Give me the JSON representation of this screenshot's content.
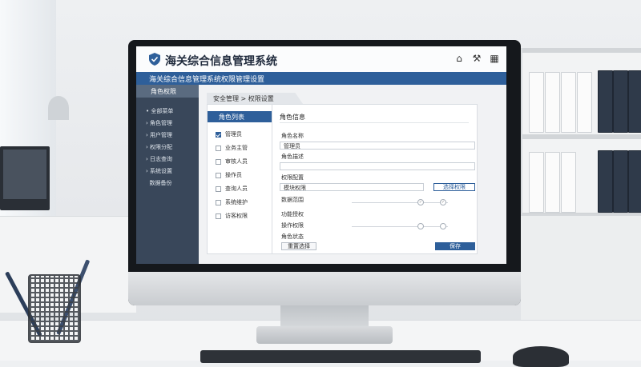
{
  "app": {
    "title": "海关综合信息管理系统",
    "tab_title": "海关综合信息管理系统权限管理设置"
  },
  "toolbar": {
    "home_icon": "⌂",
    "tools_icon": "⚒",
    "grid_icon": "▦"
  },
  "sidebar": {
    "header": "角色权限",
    "items": [
      {
        "label": "全部菜单"
      },
      {
        "label": "角色管理"
      },
      {
        "label": "用户管理"
      },
      {
        "label": "权限分配"
      },
      {
        "label": "日志查询"
      },
      {
        "label": "系统设置"
      },
      {
        "label": "数据备份"
      }
    ]
  },
  "breadcrumb": "安全管理 > 权限设置",
  "roles": {
    "header": "角色列表",
    "items": [
      {
        "label": "管理员",
        "checked": true
      },
      {
        "label": "业务主管",
        "checked": false
      },
      {
        "label": "审核人员",
        "checked": false
      },
      {
        "label": "操作员",
        "checked": false
      },
      {
        "label": "查询人员",
        "checked": false
      },
      {
        "label": "系统维护",
        "checked": false
      },
      {
        "label": "访客权限",
        "checked": false
      }
    ]
  },
  "detail": {
    "title": "角色信息",
    "role_name_label": "角色名称",
    "role_name_value": "管理员",
    "description_label": "角色描述",
    "permission_label": "权限配置",
    "permission_value": "模块权限",
    "select_button": "选择权限",
    "data_scope_label": "数据范围",
    "function_label": "功能授权",
    "operation_label": "操作权限",
    "status_label": "角色状态",
    "save_button": "保存",
    "reset_button": "重置选择"
  }
}
